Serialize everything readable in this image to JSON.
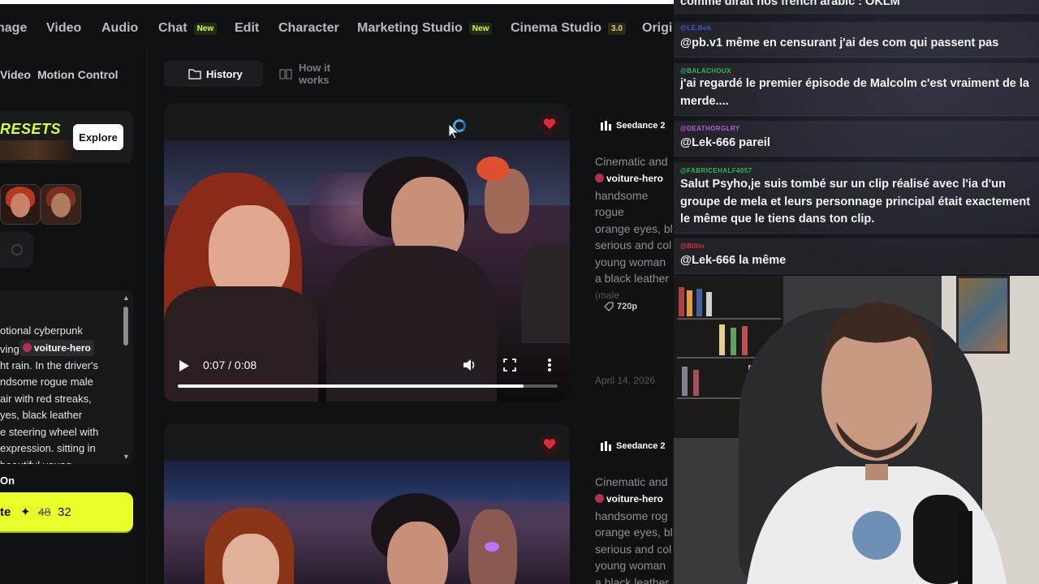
{
  "app": {
    "nav": [
      {
        "label": "nage",
        "badge": ""
      },
      {
        "label": "Video",
        "badge": ""
      },
      {
        "label": "Audio",
        "badge": ""
      },
      {
        "label": "Chat",
        "badge": "New"
      },
      {
        "label": "Edit",
        "badge": ""
      },
      {
        "label": "Character",
        "badge": ""
      },
      {
        "label": "Marketing Studio",
        "badge": "New"
      },
      {
        "label": "Cinema Studio",
        "badge": "3.0"
      },
      {
        "label": "Origi",
        "badge": ""
      }
    ],
    "subnav": [
      "Video",
      "Motion Control"
    ],
    "presets": {
      "title": "RESETS",
      "explore": "Explore"
    },
    "prompt_lines": [
      "otional cyberpunk",
      "ving",
      "ht rain. In the driver's",
      "ndsome rogue male",
      "air with red streaks,",
      "yes, black leather",
      "e steering wheel with",
      " expression. sitting in",
      "    beautiful young"
    ],
    "prompt_tag": "voiture-hero",
    "on_label": "On",
    "generate": {
      "label": "te",
      "old_cost": "48",
      "new_cost": "32"
    },
    "tabs": {
      "history": "History",
      "how": "How it works"
    },
    "videos": [
      {
        "time": "0:07 / 0:08",
        "progress": 0.91,
        "model": "Seedance 2",
        "desc_lines": [
          "Cinematic and",
          "",
          "handsome rogue",
          "orange eyes, bl",
          "serious and col",
          "young woman",
          "a black leather",
          "     (male"
        ],
        "tag": "voiture-hero",
        "resolution": "720p",
        "date": "April 14, 2026"
      },
      {
        "model": "Seedance 2",
        "desc_lines": [
          "Cinematic and",
          "",
          "handsome rog",
          "orange eyes, bl",
          "serious and col",
          "young woman",
          "a black leather"
        ],
        "tag": "voiture-hero"
      }
    ]
  },
  "chat": [
    {
      "user": "",
      "user_color": "#7a7aff",
      "text": "comme dirait nos french arabic : OKLM"
    },
    {
      "user": "@LE.Bob",
      "user_color": "#3f5bd8",
      "text": "@pb.v1 même en censurant j'ai des com qui passent pas"
    },
    {
      "user": "@BALACHOUX",
      "user_color": "#2db84d",
      "text": "j'ai regardé le premier épisode de Malcolm c'est vraiment de la merde...."
    },
    {
      "user": "@DEATHORGLRY",
      "user_color": "#c05ad8",
      "text": "@Lek-666 pareil"
    },
    {
      "user": "@FABRICEHALF4057",
      "user_color": "#2db84d",
      "text": "Salut Psyho,je suis tombé sur un clip réalisé avec l'ia d'un groupe de mela et leurs personnage principal était exactement le même que le tiens dans ton clip."
    },
    {
      "user": "@Bl0in",
      "user_color": "#e03030",
      "text": "@Lek-666 la même"
    }
  ],
  "colors": {
    "accent": "#e8ff2a",
    "heart": "#e0283c"
  }
}
